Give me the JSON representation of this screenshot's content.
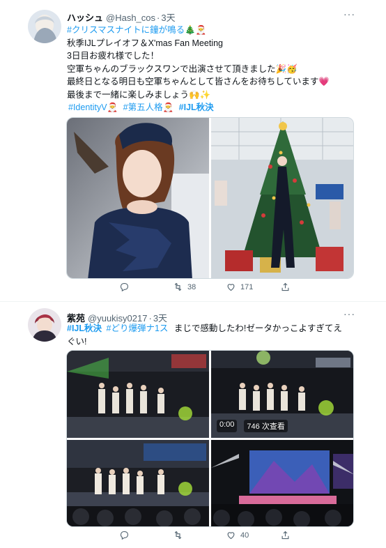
{
  "tweet1": {
    "author_name": "ハッシュ",
    "author_handle": "@Hash_cos",
    "time": "3天",
    "more": "···",
    "line1_tag": "#クリスマスナイトに鐘が鳴る",
    "line1_emoji": "🎄🎅",
    "line2": "秋季IJLプレイオフ＆X'mas Fan Meeting",
    "line3": "3日目お疲れ様でした！",
    "line4": "空軍ちゃんのブラックスワンで出演させて頂きました🎉🥳",
    "line5": "最終日となる明日も空軍ちゃんとして皆さんをお待ちしています💗",
    "line6": "最後まで一緒に楽しみましょう🙌✨",
    "tag1": "#IdentityV",
    "tag1_emoji": "🎅",
    "tag2": "#第五人格",
    "tag2_emoji": "🎅",
    "tag3": "#IJL秋決",
    "retweets": "38",
    "likes": "171"
  },
  "tweet2": {
    "author_name": "紫苑",
    "author_handle": "@yuukisy0217",
    "time": "3天",
    "more": "···",
    "tag1": "#IJL秋決",
    "tag2": "#どり爆弾ナ1ス",
    "text": "まじで感動したわ!ゼータかっこよすぎてえ",
    "text_cont": "ぐい!",
    "video_time": "0:00",
    "video_views": "746 次查看",
    "likes": "40"
  },
  "colors": {
    "link": "#1d9bf0",
    "text": "#0f1419",
    "muted": "#536471"
  }
}
